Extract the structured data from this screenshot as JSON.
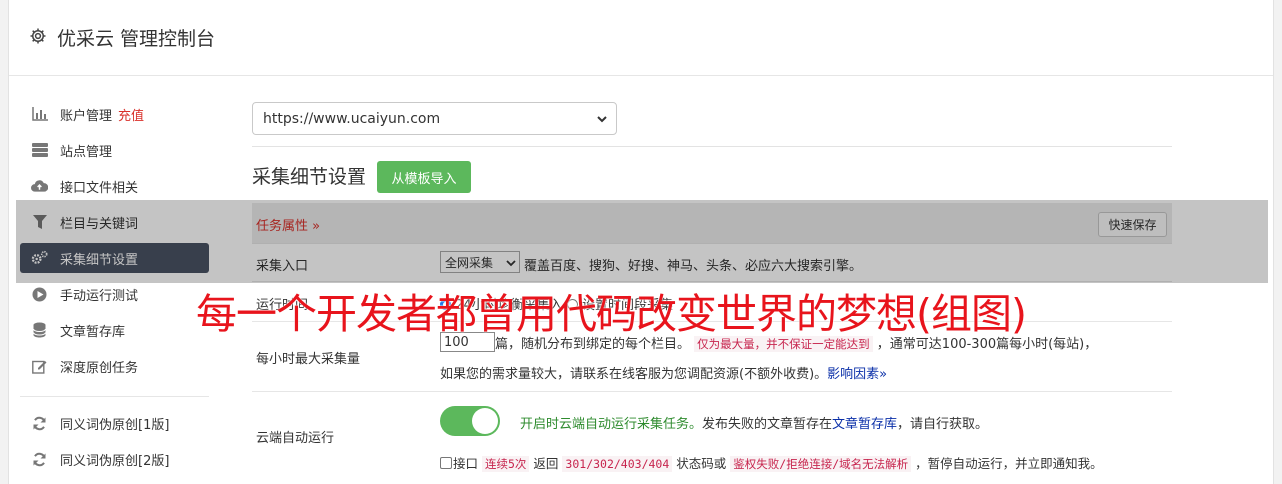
{
  "header": {
    "title": "优采云 管理控制台",
    "icon": "gear-icon"
  },
  "sidebar": {
    "items": [
      {
        "label": "账户管理",
        "badge": "充值",
        "icon": "bar-chart-icon"
      },
      {
        "label": "站点管理",
        "icon": "server-icon"
      },
      {
        "label": "接口文件相关",
        "icon": "cloud-upload-icon"
      },
      {
        "label": "栏目与关键词",
        "icon": "filter-icon"
      },
      {
        "label": "采集细节设置",
        "icon": "gears-icon",
        "active": true
      },
      {
        "label": "手动运行测试",
        "icon": "play-circle-icon"
      },
      {
        "label": "文章暂存库",
        "icon": "database-icon"
      },
      {
        "label": "深度原创任务",
        "icon": "edit-icon"
      },
      {
        "label": "同义词伪原创[1版]",
        "icon": "refresh-icon"
      },
      {
        "label": "同义词伪原创[2版]",
        "icon": "refresh-icon"
      }
    ]
  },
  "site_select": {
    "value": "https://www.ucaiyun.com"
  },
  "section": {
    "title": "采集细节设置",
    "import_button": "从模板导入"
  },
  "task_attr": {
    "title": "任务属性 »",
    "save_button": "快速保存"
  },
  "rows": {
    "entry": {
      "label": "采集入口",
      "select_value": "全网采集",
      "desc": "覆盖百度、搜狗、好搜、神马、头条、必应六大搜索引擎。"
    },
    "runtime": {
      "label": "运行时间",
      "opt1": "24小时均衡采集入",
      "opt2": "设置时间段采集"
    },
    "max_per_hour": {
      "label": "每小时最大采集量",
      "value": "100",
      "text1": "篇，随机分布到绑定的每个栏目。",
      "code1": "仅为最大量，并不保证一定能达到",
      "text2": "，通常可达100-300篇每小时(每站)，",
      "text3": "如果您的需求量较大，请联系在线客服为您调配资源(不额外收费)。",
      "link": "影响因素»"
    },
    "cloud": {
      "label": "云端自动运行",
      "green_text": "开启时云端自动运行采集任务。",
      "text1": "发布失败的文章暂存在",
      "link": "文章暂存库",
      "text2": "，请自行获取。",
      "cb_prefix": "接口",
      "code1": "连续5次",
      "text3": "返回",
      "code2": "301/302/403/404",
      "text4": "状态码或",
      "code3": "鉴权失败/拒绝连接/域名无法解析",
      "text5": "，暂停自动运行，并立即通知我。"
    }
  },
  "watermark": "每一个开发者都曾用代码改变世界的梦想(组图)"
}
